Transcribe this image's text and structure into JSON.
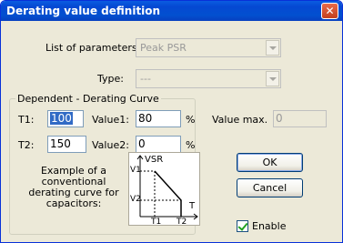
{
  "window": {
    "title": "Derating value definition",
    "close_glyph": "✕"
  },
  "parameters": {
    "label": "List of parameters:",
    "value": "Peak PSR"
  },
  "type": {
    "label": "Type:",
    "value": "---"
  },
  "curve": {
    "group_title": "Dependent - Derating Curve",
    "t1_label": "T1:",
    "t1_value": "100",
    "value1_label": "Value1:",
    "value1_value": "80",
    "value1_unit": "%",
    "t2_label": "T2:",
    "t2_value": "150",
    "value2_label": "Value2:",
    "value2_value": "0",
    "value2_unit": "%",
    "example_text": [
      "Example of a",
      "conventional",
      "derating curve for",
      "capacitors:"
    ]
  },
  "value_max": {
    "label": "Value max.",
    "value": "0"
  },
  "buttons": {
    "ok": "OK",
    "cancel": "Cancel"
  },
  "enable": {
    "label": "Enable",
    "checked": true
  },
  "chart_data": {
    "type": "line",
    "series": [
      {
        "x": [
          "T1",
          "T2"
        ],
        "values": [
          "V1",
          "V2"
        ]
      }
    ],
    "labels": {
      "ylabel": "VSR",
      "xlabel": "T",
      "y_ticks": [
        "V1",
        "V2"
      ],
      "x_ticks": [
        "T1",
        "T2"
      ]
    }
  }
}
